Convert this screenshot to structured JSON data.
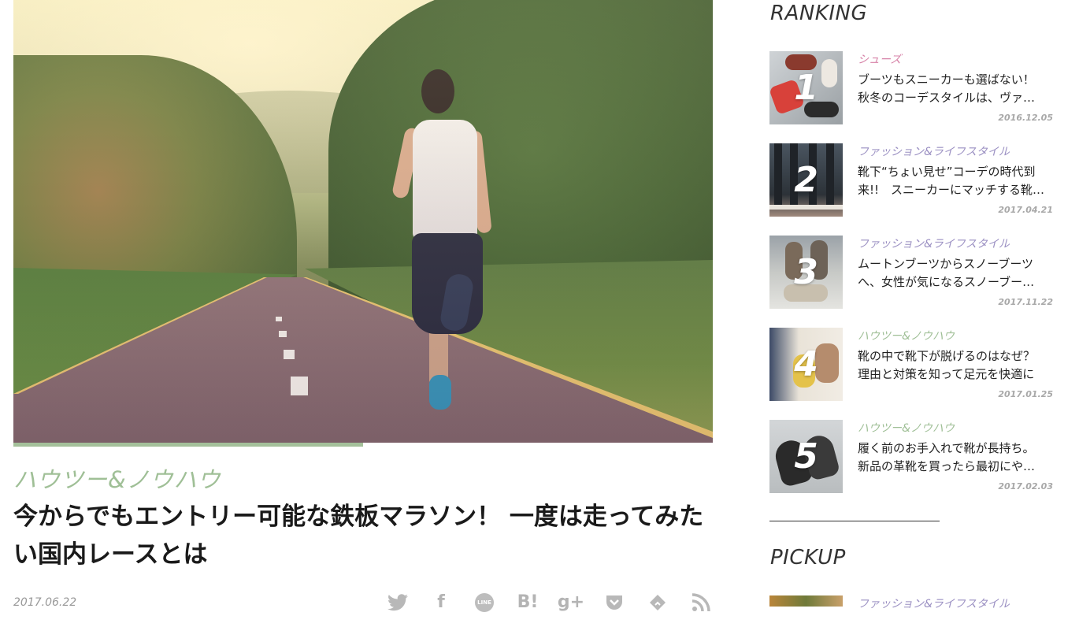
{
  "article": {
    "category": "ハウツー&ノウハウ",
    "title": "今からでもエントリー可能な鉄板マラソン！ 一度は走ってみたい国内レースとは",
    "date": "2017.06.22",
    "reading_progress": 0.5
  },
  "share": {
    "icons": [
      "twitter-icon",
      "facebook-icon",
      "line-icon",
      "hatena-bookmark-icon",
      "google-plus-icon",
      "pocket-icon",
      "feedly-icon",
      "rss-icon"
    ],
    "glyphs": [
      "🐦",
      "f",
      "LINE",
      "B!",
      "g+",
      "❯",
      "◆",
      "☰"
    ]
  },
  "sidebar": {
    "ranking_title": "RANKING",
    "pickup_title": "PICKUP",
    "ranking": [
      {
        "rank": "1",
        "category": "シューズ",
        "category_color": "#d783a8",
        "title_line1": "ブーツもスニーカーも選ばない！",
        "title_line2": "秋冬のコーデスタイルは、ヴァ…",
        "date": "2016.12.05"
      },
      {
        "rank": "2",
        "category": "ファッション&ライフスタイル",
        "category_color": "#9a8fc2",
        "title_line1": "靴下“ちょい見せ”コーデの時代到",
        "title_line2": "来!!　スニーカーにマッチする靴…",
        "date": "2017.04.21"
      },
      {
        "rank": "3",
        "category": "ファッション&ライフスタイル",
        "category_color": "#9a8fc2",
        "title_line1": "ムートンブーツからスノーブーツ",
        "title_line2": "へ、女性が気になるスノーブー…",
        "date": "2017.11.22"
      },
      {
        "rank": "4",
        "category": "ハウツー&ノウハウ",
        "category_color": "#9fbf96",
        "title_line1": "靴の中で靴下が脱げるのはなぜ？",
        "title_line2": "理由と対策を知って足元を快適に",
        "date": "2017.01.25"
      },
      {
        "rank": "5",
        "category": "ハウツー&ノウハウ",
        "category_color": "#9fbf96",
        "title_line1": "履く前のお手入れで靴が長持ち。",
        "title_line2": "新品の革靴を買ったら最初にや…",
        "date": "2017.02.03"
      }
    ],
    "pickup": [
      {
        "category": "ファッション&ライフスタイル",
        "category_color": "#9a8fc2"
      }
    ]
  }
}
